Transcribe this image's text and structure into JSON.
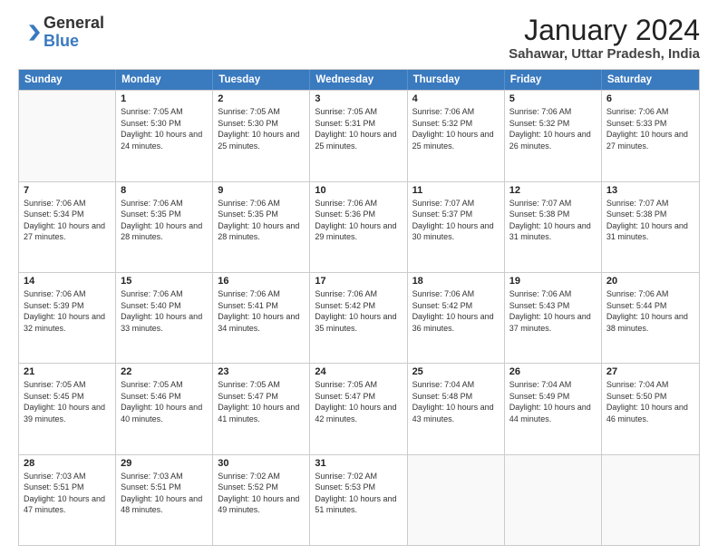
{
  "header": {
    "logo_general": "General",
    "logo_blue": "Blue",
    "month_year": "January 2024",
    "location": "Sahawar, Uttar Pradesh, India"
  },
  "days_of_week": [
    "Sunday",
    "Monday",
    "Tuesday",
    "Wednesday",
    "Thursday",
    "Friday",
    "Saturday"
  ],
  "weeks": [
    [
      {
        "day": "",
        "empty": true
      },
      {
        "day": "1",
        "sunrise": "7:05 AM",
        "sunset": "5:30 PM",
        "daylight": "10 hours and 24 minutes."
      },
      {
        "day": "2",
        "sunrise": "7:05 AM",
        "sunset": "5:30 PM",
        "daylight": "10 hours and 25 minutes."
      },
      {
        "day": "3",
        "sunrise": "7:05 AM",
        "sunset": "5:31 PM",
        "daylight": "10 hours and 25 minutes."
      },
      {
        "day": "4",
        "sunrise": "7:06 AM",
        "sunset": "5:32 PM",
        "daylight": "10 hours and 25 minutes."
      },
      {
        "day": "5",
        "sunrise": "7:06 AM",
        "sunset": "5:32 PM",
        "daylight": "10 hours and 26 minutes."
      },
      {
        "day": "6",
        "sunrise": "7:06 AM",
        "sunset": "5:33 PM",
        "daylight": "10 hours and 27 minutes."
      }
    ],
    [
      {
        "day": "7",
        "sunrise": "7:06 AM",
        "sunset": "5:34 PM",
        "daylight": "10 hours and 27 minutes."
      },
      {
        "day": "8",
        "sunrise": "7:06 AM",
        "sunset": "5:35 PM",
        "daylight": "10 hours and 28 minutes."
      },
      {
        "day": "9",
        "sunrise": "7:06 AM",
        "sunset": "5:35 PM",
        "daylight": "10 hours and 28 minutes."
      },
      {
        "day": "10",
        "sunrise": "7:06 AM",
        "sunset": "5:36 PM",
        "daylight": "10 hours and 29 minutes."
      },
      {
        "day": "11",
        "sunrise": "7:07 AM",
        "sunset": "5:37 PM",
        "daylight": "10 hours and 30 minutes."
      },
      {
        "day": "12",
        "sunrise": "7:07 AM",
        "sunset": "5:38 PM",
        "daylight": "10 hours and 31 minutes."
      },
      {
        "day": "13",
        "sunrise": "7:07 AM",
        "sunset": "5:38 PM",
        "daylight": "10 hours and 31 minutes."
      }
    ],
    [
      {
        "day": "14",
        "sunrise": "7:06 AM",
        "sunset": "5:39 PM",
        "daylight": "10 hours and 32 minutes."
      },
      {
        "day": "15",
        "sunrise": "7:06 AM",
        "sunset": "5:40 PM",
        "daylight": "10 hours and 33 minutes."
      },
      {
        "day": "16",
        "sunrise": "7:06 AM",
        "sunset": "5:41 PM",
        "daylight": "10 hours and 34 minutes."
      },
      {
        "day": "17",
        "sunrise": "7:06 AM",
        "sunset": "5:42 PM",
        "daylight": "10 hours and 35 minutes."
      },
      {
        "day": "18",
        "sunrise": "7:06 AM",
        "sunset": "5:42 PM",
        "daylight": "10 hours and 36 minutes."
      },
      {
        "day": "19",
        "sunrise": "7:06 AM",
        "sunset": "5:43 PM",
        "daylight": "10 hours and 37 minutes."
      },
      {
        "day": "20",
        "sunrise": "7:06 AM",
        "sunset": "5:44 PM",
        "daylight": "10 hours and 38 minutes."
      }
    ],
    [
      {
        "day": "21",
        "sunrise": "7:05 AM",
        "sunset": "5:45 PM",
        "daylight": "10 hours and 39 minutes."
      },
      {
        "day": "22",
        "sunrise": "7:05 AM",
        "sunset": "5:46 PM",
        "daylight": "10 hours and 40 minutes."
      },
      {
        "day": "23",
        "sunrise": "7:05 AM",
        "sunset": "5:47 PM",
        "daylight": "10 hours and 41 minutes."
      },
      {
        "day": "24",
        "sunrise": "7:05 AM",
        "sunset": "5:47 PM",
        "daylight": "10 hours and 42 minutes."
      },
      {
        "day": "25",
        "sunrise": "7:04 AM",
        "sunset": "5:48 PM",
        "daylight": "10 hours and 43 minutes."
      },
      {
        "day": "26",
        "sunrise": "7:04 AM",
        "sunset": "5:49 PM",
        "daylight": "10 hours and 44 minutes."
      },
      {
        "day": "27",
        "sunrise": "7:04 AM",
        "sunset": "5:50 PM",
        "daylight": "10 hours and 46 minutes."
      }
    ],
    [
      {
        "day": "28",
        "sunrise": "7:03 AM",
        "sunset": "5:51 PM",
        "daylight": "10 hours and 47 minutes."
      },
      {
        "day": "29",
        "sunrise": "7:03 AM",
        "sunset": "5:51 PM",
        "daylight": "10 hours and 48 minutes."
      },
      {
        "day": "30",
        "sunrise": "7:02 AM",
        "sunset": "5:52 PM",
        "daylight": "10 hours and 49 minutes."
      },
      {
        "day": "31",
        "sunrise": "7:02 AM",
        "sunset": "5:53 PM",
        "daylight": "10 hours and 51 minutes."
      },
      {
        "day": "",
        "empty": true
      },
      {
        "day": "",
        "empty": true
      },
      {
        "day": "",
        "empty": true
      }
    ]
  ]
}
